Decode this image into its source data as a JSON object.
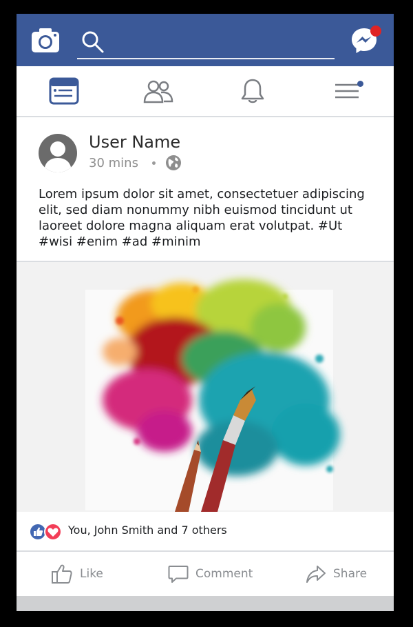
{
  "search": {
    "placeholder": ""
  },
  "nav": {
    "tabs": [
      "news-feed",
      "friends",
      "notifications",
      "menu"
    ]
  },
  "post": {
    "user_name": "User Name",
    "time": "30 mins",
    "text": "Lorem ipsum dolor sit amet, consectetuer adipiscing elit, sed diam nonummy nibh euismod tincidunt ut laoreet dolore magna aliquam erat volutpat. #Ut #wisi #enim #ad #minim"
  },
  "reactions": {
    "summary": "You, John Smith and 7 others"
  },
  "actions": {
    "like": "Like",
    "comment": "Comment",
    "share": "Share"
  },
  "colors": {
    "brand": "#3b5998",
    "notification": "#e02424",
    "love": "#f33e58"
  },
  "icons": [
    "camera-icon",
    "search-icon",
    "messenger-icon",
    "news-feed-icon",
    "friends-icon",
    "bell-icon",
    "menu-icon",
    "globe-icon",
    "like-icon",
    "comment-icon",
    "share-icon"
  ]
}
